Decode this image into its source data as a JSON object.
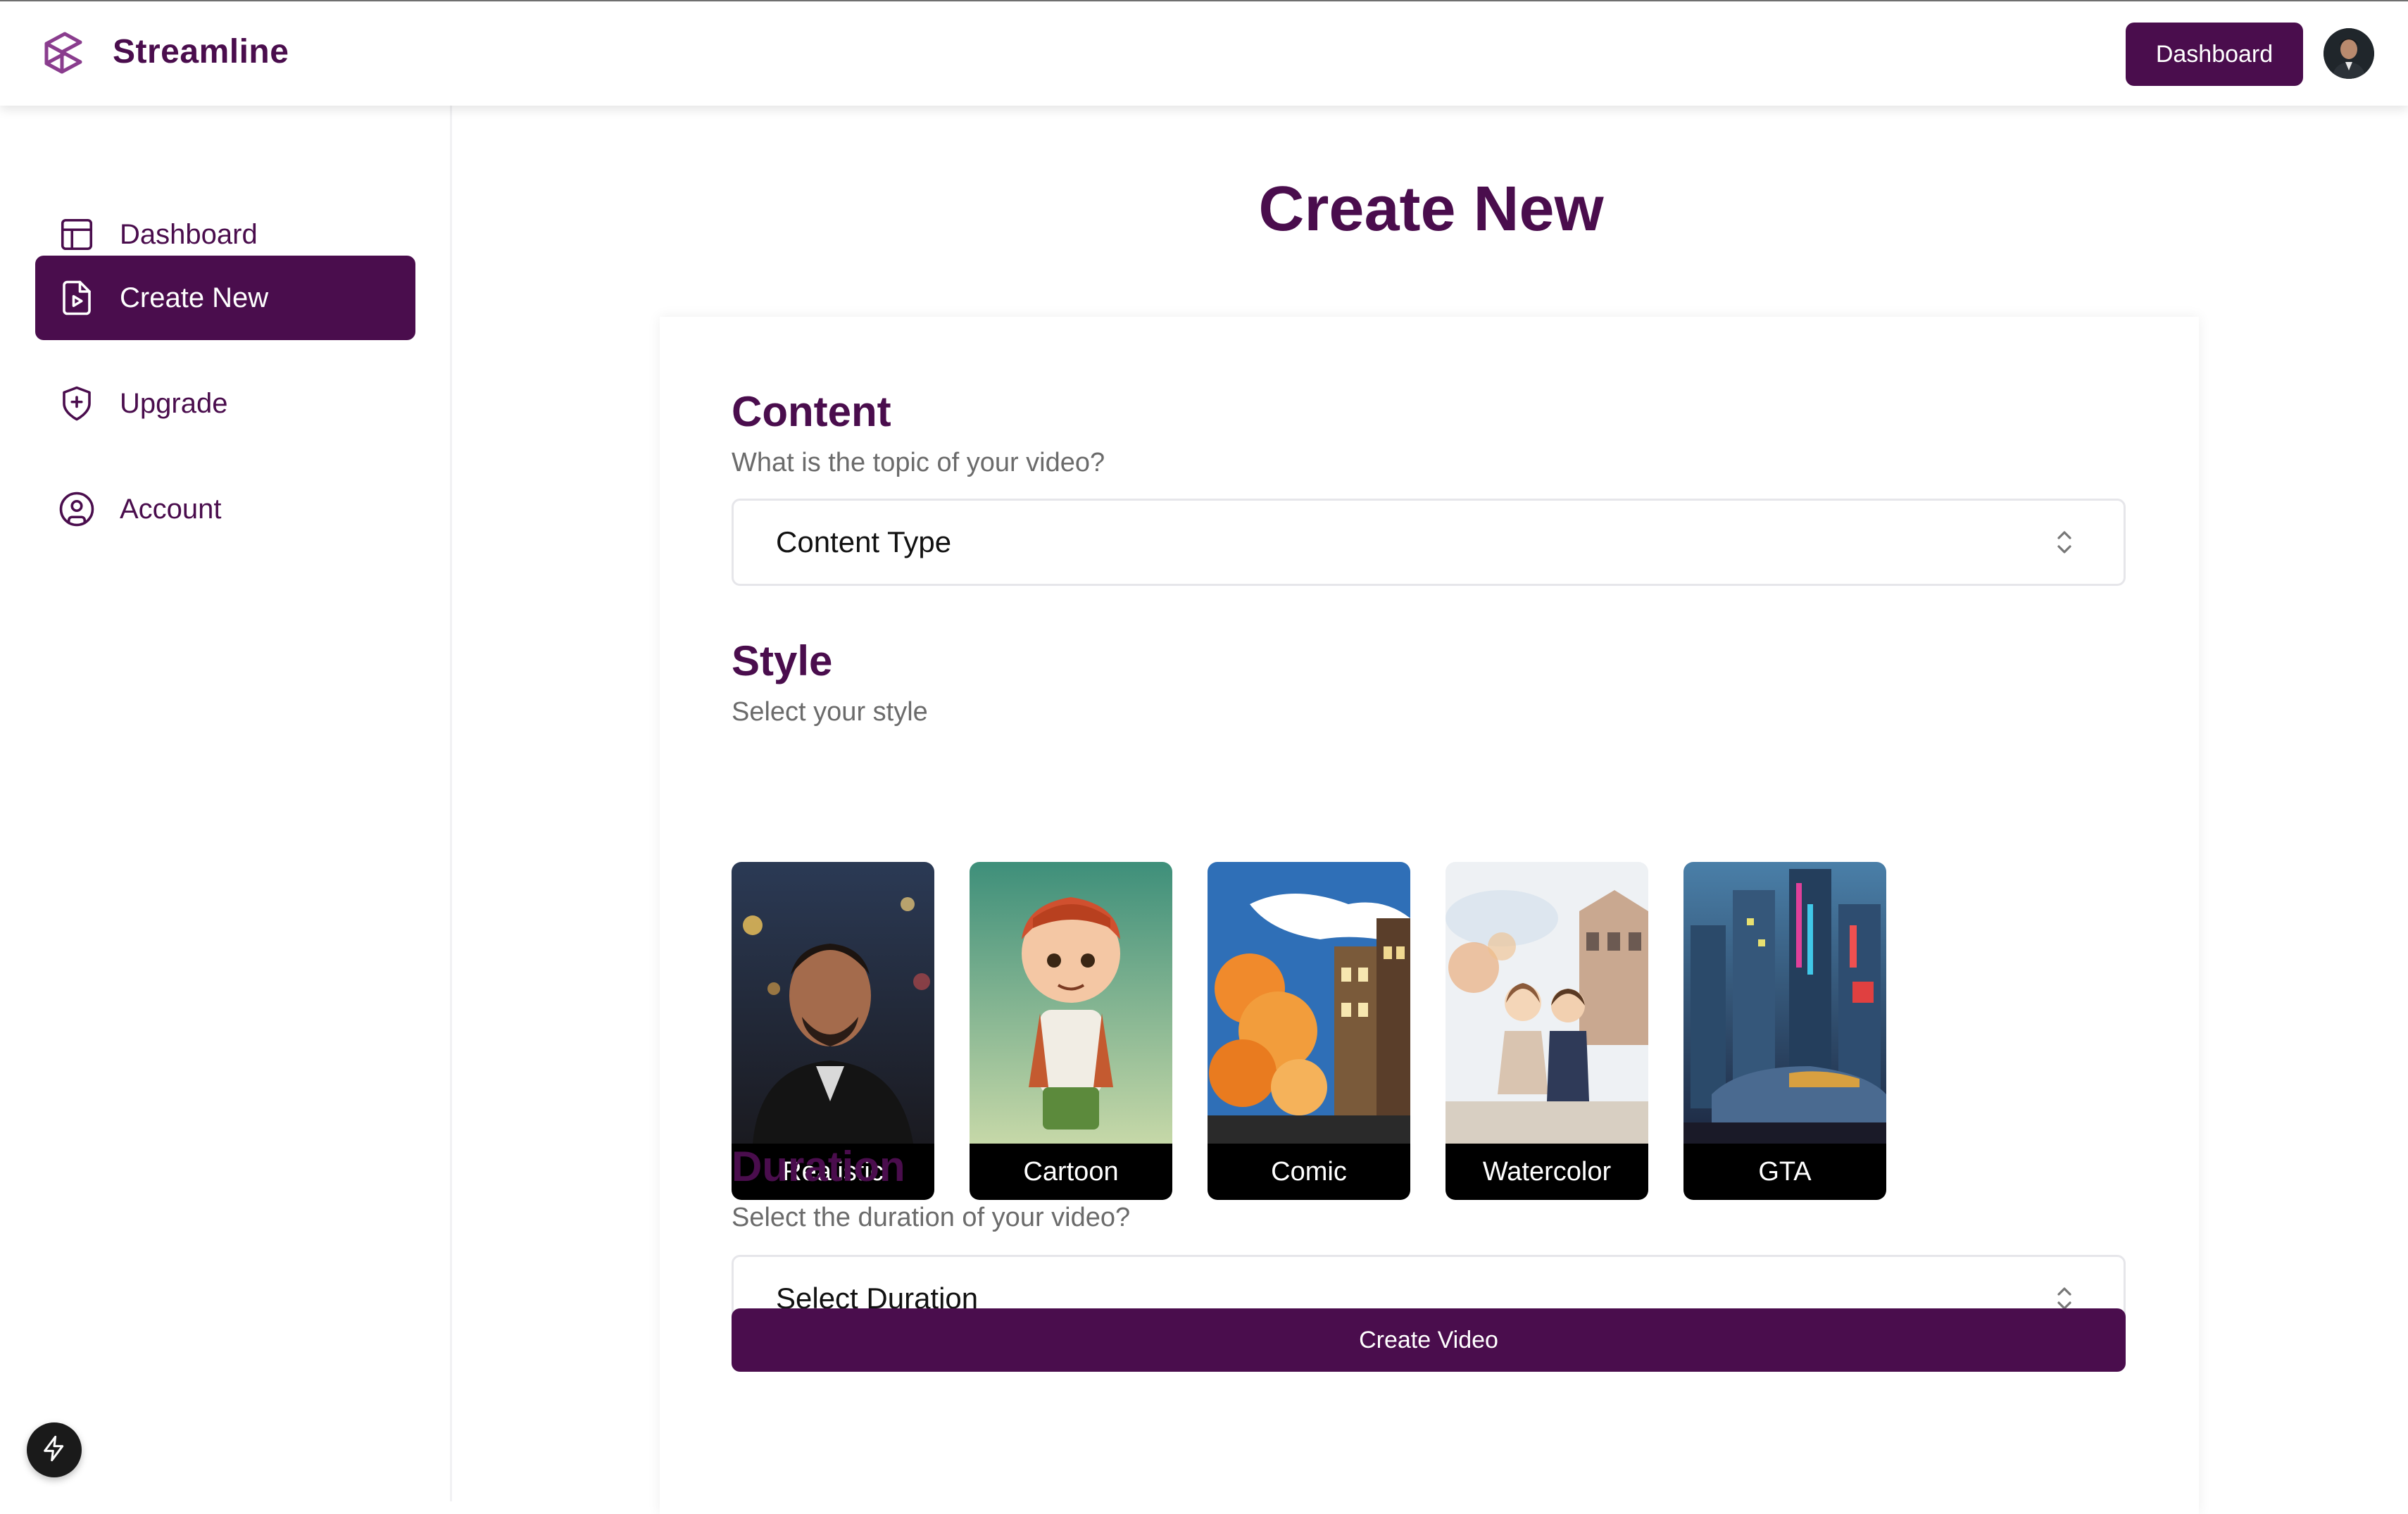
{
  "header": {
    "brand": "Streamline",
    "dashboard_label": "Dashboard"
  },
  "sidebar": {
    "items": [
      {
        "label": "Dashboard",
        "icon": "layout-icon",
        "active": false
      },
      {
        "label": "Create New",
        "icon": "file-video-icon",
        "active": true
      },
      {
        "label": "Upgrade",
        "icon": "shield-plus-icon",
        "active": false
      },
      {
        "label": "Account",
        "icon": "user-circle-icon",
        "active": false
      }
    ]
  },
  "main": {
    "title": "Create New",
    "content": {
      "heading": "Content",
      "subheading": "What is the topic of your video?",
      "select_value": "Content Type"
    },
    "style": {
      "heading": "Style",
      "subheading": "Select your style",
      "options": [
        "Realistic",
        "Cartoon",
        "Comic",
        "Watercolor",
        "GTA"
      ]
    },
    "duration": {
      "heading": "Duration",
      "subheading": "Select the duration of your video?",
      "select_value": "Select Duration"
    },
    "create_button": "Create Video"
  },
  "colors": {
    "brand": "#4a0d4d",
    "muted_text": "#6b6b6b",
    "border": "#e6e6ea"
  }
}
